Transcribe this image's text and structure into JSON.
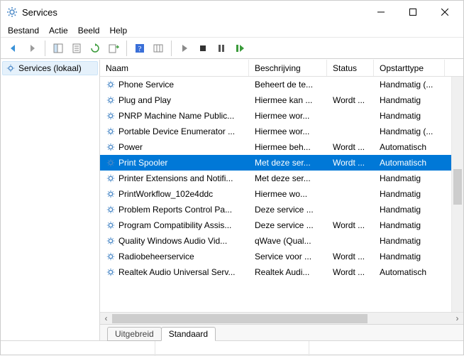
{
  "window": {
    "title": "Services"
  },
  "menu": {
    "file": "Bestand",
    "action": "Actie",
    "view": "Beeld",
    "help": "Help"
  },
  "sidebar": {
    "root": "Services (lokaal)"
  },
  "columns": {
    "name": "Naam",
    "description": "Beschrijving",
    "status": "Status",
    "startup": "Opstarttype"
  },
  "tabs": {
    "extended": "Uitgebreid",
    "standard": "Standaard"
  },
  "services": [
    {
      "name": "Phone Service",
      "desc": "Beheert de te...",
      "status": "",
      "start": "Handmatig (..."
    },
    {
      "name": "Plug and Play",
      "desc": "Hiermee kan ...",
      "status": "Wordt ...",
      "start": "Handmatig"
    },
    {
      "name": "PNRP Machine Name Public...",
      "desc": "Hiermee wor...",
      "status": "",
      "start": "Handmatig"
    },
    {
      "name": "Portable Device Enumerator ...",
      "desc": "Hiermee wor...",
      "status": "",
      "start": "Handmatig (..."
    },
    {
      "name": "Power",
      "desc": "Hiermee beh...",
      "status": "Wordt ...",
      "start": "Automatisch"
    },
    {
      "name": "Print Spooler",
      "desc": "Met deze ser...",
      "status": "Wordt ...",
      "start": "Automatisch",
      "selected": true
    },
    {
      "name": "Printer Extensions and Notifi...",
      "desc": "Met deze ser...",
      "status": "",
      "start": "Handmatig"
    },
    {
      "name": "PrintWorkflow_102e4ddc",
      "desc": "Hiermee wo...",
      "status": "",
      "start": "Handmatig"
    },
    {
      "name": "Problem Reports Control Pa...",
      "desc": "Deze service ...",
      "status": "",
      "start": "Handmatig"
    },
    {
      "name": "Program Compatibility Assis...",
      "desc": "Deze service ...",
      "status": "Wordt ...",
      "start": "Handmatig"
    },
    {
      "name": "Quality Windows Audio Vid...",
      "desc": "qWave (Qual...",
      "status": "",
      "start": "Handmatig"
    },
    {
      "name": "Radiobeheerservice",
      "desc": "Service voor ...",
      "status": "Wordt ...",
      "start": "Handmatig"
    },
    {
      "name": "Realtek Audio Universal Serv...",
      "desc": "Realtek Audi...",
      "status": "Wordt ...",
      "start": "Automatisch"
    }
  ],
  "icons": {
    "gear": "gear-icon",
    "minimize": "−",
    "close": "✕"
  },
  "selected_index": 5,
  "active_tab": "standard"
}
